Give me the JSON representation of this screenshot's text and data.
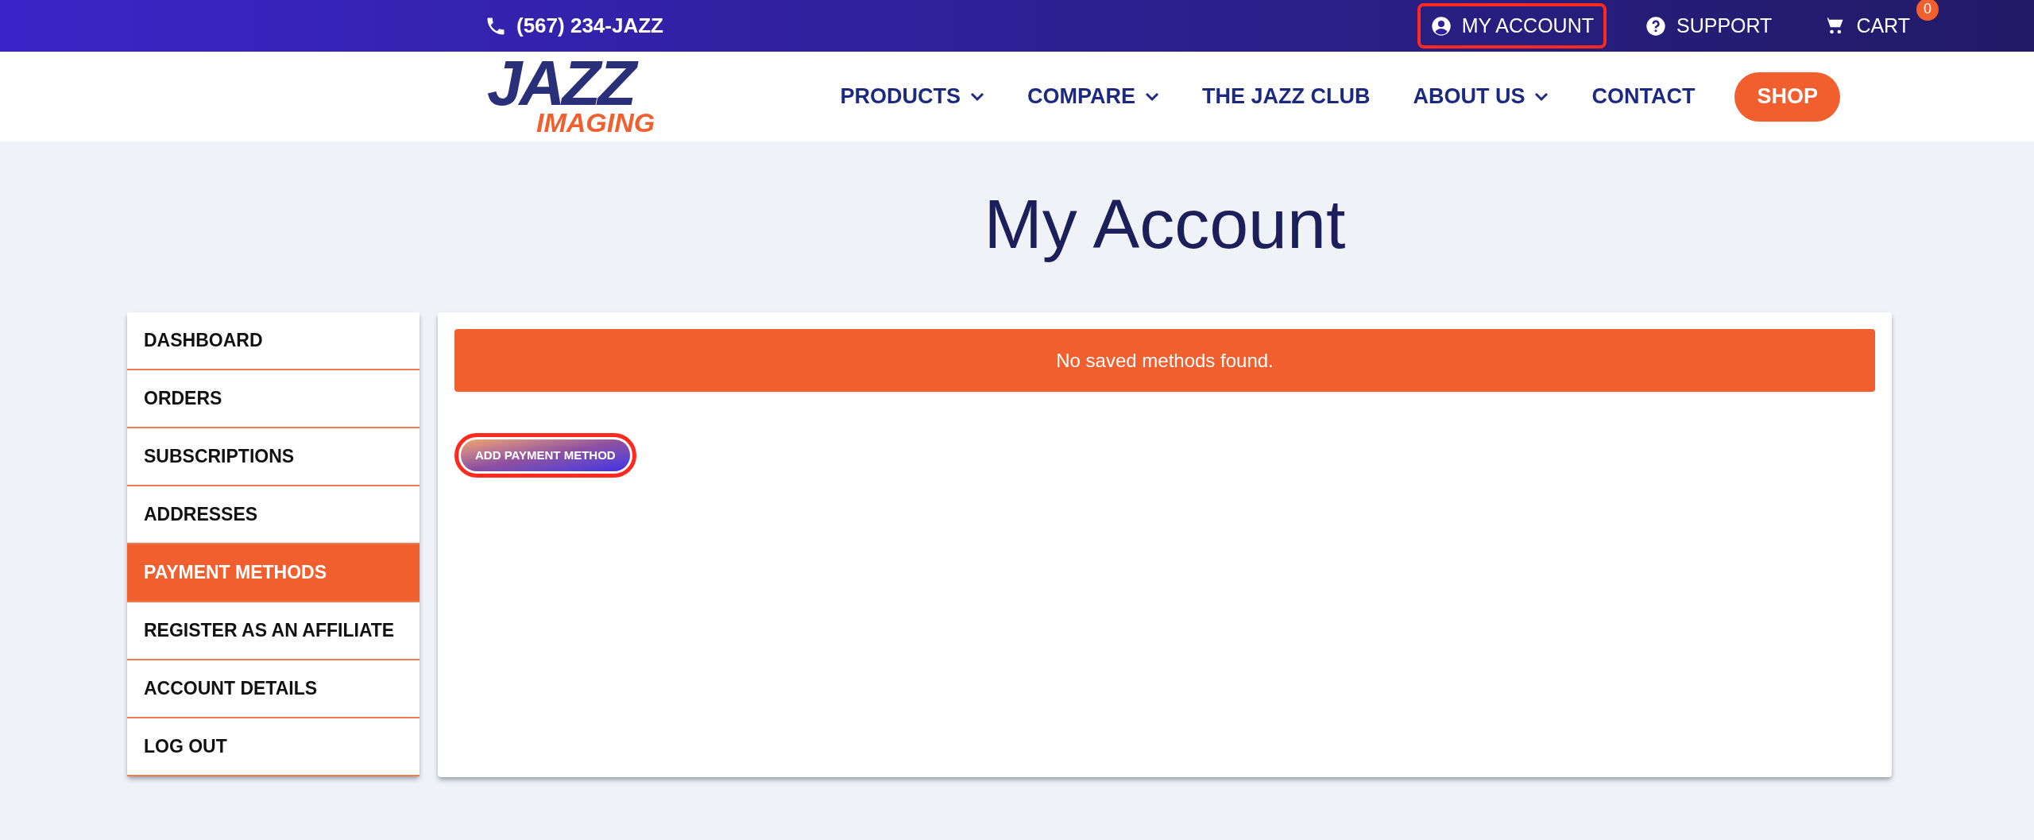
{
  "top_bar": {
    "phone": "(567) 234-JAZZ",
    "links": [
      {
        "kind": "account",
        "label": "MY ACCOUNT",
        "highlighted": true
      },
      {
        "kind": "support",
        "label": "SUPPORT",
        "highlighted": false
      },
      {
        "kind": "cart",
        "label": "CART",
        "highlighted": false
      }
    ],
    "cart_count": "0"
  },
  "logo": {
    "top": "JAZZ",
    "bottom": "IMAGING"
  },
  "nav": [
    {
      "label": "PRODUCTS",
      "dropdown": true
    },
    {
      "label": "COMPARE",
      "dropdown": true
    },
    {
      "label": "THE JAZZ CLUB",
      "dropdown": false
    },
    {
      "label": "ABOUT US",
      "dropdown": true
    },
    {
      "label": "CONTACT",
      "dropdown": false
    }
  ],
  "shop_button": "SHOP",
  "page_title": "My Account",
  "sidebar": {
    "items": [
      {
        "label": "DASHBOARD",
        "selected": false
      },
      {
        "label": "ORDERS",
        "selected": false
      },
      {
        "label": "SUBSCRIPTIONS",
        "selected": false
      },
      {
        "label": "ADDRESSES",
        "selected": false
      },
      {
        "label": "PAYMENT METHODS",
        "selected": true
      },
      {
        "label": "REGISTER AS AN AFFILIATE",
        "selected": false
      },
      {
        "label": "ACCOUNT DETAILS",
        "selected": false
      },
      {
        "label": "LOG OUT",
        "selected": false
      }
    ]
  },
  "notice": "No saved methods found.",
  "add_button": {
    "label": "ADD PAYMENT METHOD",
    "highlighted": true
  }
}
